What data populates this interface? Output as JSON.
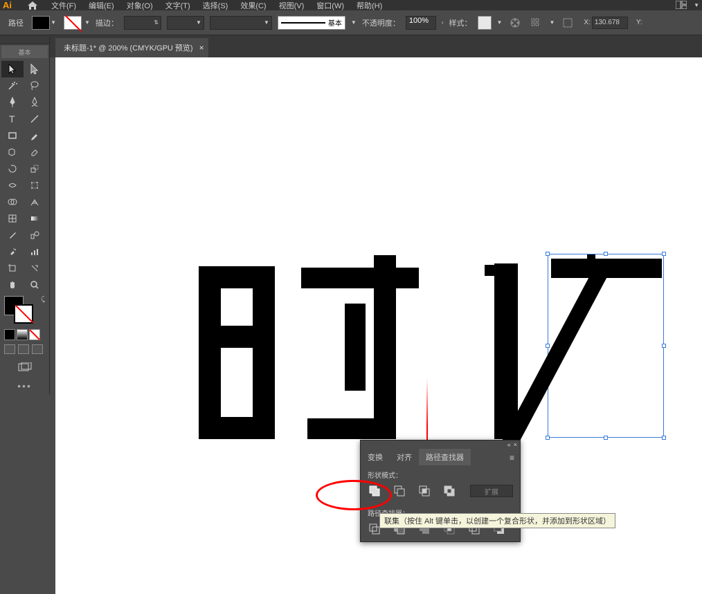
{
  "app": {
    "logo": "Ai"
  },
  "menu": {
    "file": "文件(F)",
    "edit": "编辑(E)",
    "object": "对象(O)",
    "type": "文字(T)",
    "select": "选择(S)",
    "effect": "效果(C)",
    "view": "视图(V)",
    "window": "窗口(W)",
    "help": "帮助(H)"
  },
  "control": {
    "selection_label": "路径",
    "stroke_label": "描边：",
    "stroke_weight": "",
    "stroke_style_label": "基本",
    "opacity_label": "不透明度：",
    "opacity_value": "100%",
    "style_label": "样式：",
    "x_label": "X:",
    "x_value": "130.678",
    "y_label": "Y:"
  },
  "tab": {
    "title": "未标题-1* @ 200% (CMYK/GPU 预览)",
    "close": "×"
  },
  "pathfinder": {
    "tab_transform": "变换",
    "tab_align": "对齐",
    "tab_pathfinder": "路径查找器",
    "shape_modes_label": "形状模式：",
    "pathfinders_label": "路径查找器：",
    "expand_label": "扩展",
    "tooltip": "联集（按住 Alt 键单击，以创建一个复合形状，并添加到形状区域）"
  },
  "toolbox": {
    "tab": "基本"
  }
}
